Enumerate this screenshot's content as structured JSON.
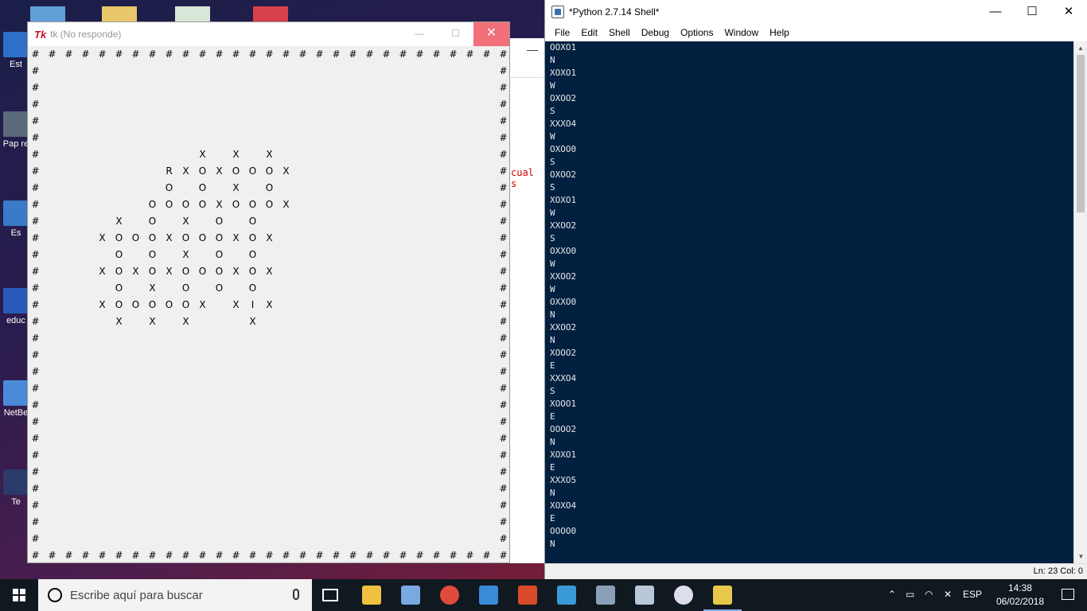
{
  "desktop": {
    "icons": [
      "Est",
      "Pap re",
      "Es",
      "educ",
      "NetBe",
      "Te"
    ]
  },
  "background_window": {
    "minimize": "—",
    "red_text": "cual s"
  },
  "tk_window": {
    "title": "tk (No responde)",
    "app_icon": "tk-feather-icon",
    "min": "—",
    "max": "☐",
    "close": "✕",
    "grid": [
      "# # # # # # # # # # # # # # # # # # # # # # # # # # # # #",
      "#                                                       #",
      "#                                                       #",
      "#                                                       #",
      "#                                                       #",
      "#                                                       #",
      "#                   X   X   X                           #",
      "#               R X O X O O O X                         #",
      "#               O   O   X   O                           #",
      "#             O O O O X O O O X                         #",
      "#         X   O   X   O   O                             #",
      "#       X O O O X O O O X O X                           #",
      "#         O   O   X   O   O                             #",
      "#       X O X O X O O O X O X                           #",
      "#         O   X   O   O   O                             #",
      "#       X O O O O O X   X I X                           #",
      "#         X   X   X       X                             #",
      "#                                                       #",
      "#                                                       #",
      "#                                                       #",
      "#                                                       #",
      "#                                                       #",
      "#                                                       #",
      "#                                                       #",
      "#                                                       #",
      "#                                                       #",
      "#                                                       #",
      "#                                                       #",
      "#                                                       #",
      "#                                                       #",
      "# # # # # # # # # # # # # # # # # # # # # # # # # # # # #"
    ]
  },
  "shell": {
    "title": "*Python 2.7.14 Shell*",
    "min": "—",
    "max": "☐",
    "close": "✕",
    "menu": [
      "File",
      "Edit",
      "Shell",
      "Debug",
      "Options",
      "Window",
      "Help"
    ],
    "lines": [
      "OOXO1",
      "N",
      "XOXO1",
      "W",
      "OXOO2",
      "S",
      "XXXO4",
      "W",
      "OXOO0",
      "S",
      "OXOO2",
      "S",
      "XOXO1",
      "W",
      "XXOO2",
      "S",
      "OXXO0",
      "W",
      "XXOO2",
      "W",
      "OXXO0",
      "N",
      "XXOO2",
      "N",
      "XOOO2",
      "E",
      "XXXO4",
      "S",
      "XOOO1",
      "E",
      "OOOO2",
      "N",
      "XOXO1",
      "E",
      "XXXO5",
      "N",
      "XOXO4",
      "E",
      "OOOO0",
      "N"
    ],
    "status": "Ln: 23   Col: 0"
  },
  "taskbar": {
    "search_placeholder": "Escribe aquí para buscar",
    "language": "ESP",
    "time": "14:38",
    "date": "06/02/2018"
  }
}
